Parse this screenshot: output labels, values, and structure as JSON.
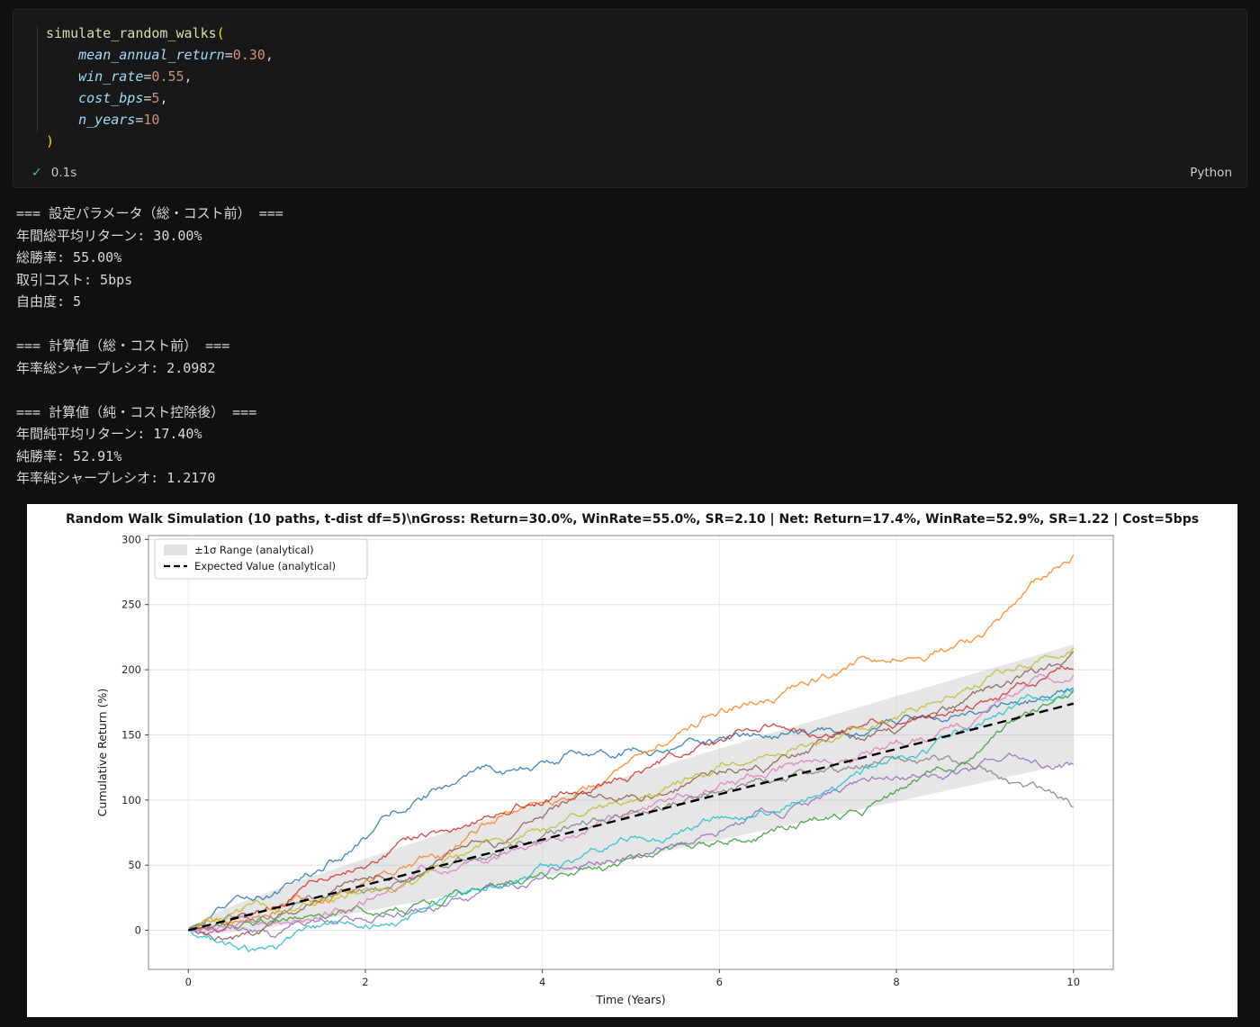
{
  "cell": {
    "execution_time": "0.1s",
    "kernel": "Python",
    "code_lines": [
      [
        {
          "text": "simulate_random_walks",
          "type": "func"
        },
        {
          "text": "(",
          "type": "bracket"
        }
      ],
      [
        {
          "text": "    ",
          "type": "plain"
        },
        {
          "text": "mean_annual_return",
          "type": "param"
        },
        {
          "text": "=",
          "type": "op"
        },
        {
          "text": "0.30",
          "type": "num"
        },
        {
          "text": ",",
          "type": "plain"
        }
      ],
      [
        {
          "text": "    ",
          "type": "plain"
        },
        {
          "text": "win_rate",
          "type": "param"
        },
        {
          "text": "=",
          "type": "op"
        },
        {
          "text": "0.55",
          "type": "num"
        },
        {
          "text": ",",
          "type": "plain"
        }
      ],
      [
        {
          "text": "    ",
          "type": "plain"
        },
        {
          "text": "cost_bps",
          "type": "param"
        },
        {
          "text": "=",
          "type": "op"
        },
        {
          "text": "5",
          "type": "num"
        },
        {
          "text": ",",
          "type": "plain"
        }
      ],
      [
        {
          "text": "    ",
          "type": "plain"
        },
        {
          "text": "n_years",
          "type": "param"
        },
        {
          "text": "=",
          "type": "op"
        },
        {
          "text": "10",
          "type": "num"
        }
      ],
      [
        {
          "text": ")",
          "type": "bracket"
        }
      ]
    ]
  },
  "output": {
    "lines": [
      "=== 設定パラメータ（総・コスト前） ===",
      "年間総平均リターン: 30.00%",
      "総勝率: 55.00%",
      "取引コスト: 5bps",
      "自由度: 5",
      "",
      "=== 計算値（総・コスト前） ===",
      "年率総シャープレシオ: 2.0982",
      "",
      "=== 計算値（純・コスト控除後） ===",
      "年間純平均リターン: 17.40%",
      "純勝率: 52.91%",
      "年率純シャープレシオ: 1.2170"
    ]
  },
  "chart_data": {
    "type": "line",
    "title": "Random Walk Simulation (10 paths, t-dist df=5)\\nGross: Return=30.0%, WinRate=55.0%, SR=2.10 | Net: Return=17.4%, WinRate=52.9%, SR=1.22 | Cost=5bps",
    "xlabel": "Time (Years)",
    "ylabel": "Cumulative Return (%)",
    "xlim": [
      -0.45,
      10.45
    ],
    "ylim": [
      -30,
      303
    ],
    "xticks": [
      0,
      2,
      4,
      6,
      8,
      10
    ],
    "yticks": [
      0,
      50,
      100,
      150,
      200,
      250,
      300
    ],
    "grid": true,
    "legend": {
      "position": "upper left",
      "entries": [
        {
          "label": "±1σ Range (analytical)",
          "type": "patch",
          "color": "#d9d9d9"
        },
        {
          "label": "Expected Value (analytical)",
          "type": "dashed-line",
          "color": "#000000"
        }
      ]
    },
    "expected_value": {
      "slope_pct_per_year": 17.4,
      "x": [
        0,
        10
      ],
      "y": [
        0,
        174
      ]
    },
    "sigma_band": {
      "mean_slope_pct_per_year": 17.4,
      "sigma_annual_pct": 14.3
    },
    "n_paths": 10,
    "series": [
      {
        "name": "path-1",
        "color": "#1f77b4",
        "x": [
          0,
          1,
          2,
          3,
          4,
          5,
          6,
          7,
          8,
          9,
          10
        ],
        "y": [
          0,
          28,
          70,
          112,
          130,
          138,
          148,
          150,
          158,
          168,
          186
        ]
      },
      {
        "name": "path-2",
        "color": "#ff7f0e",
        "x": [
          0,
          1,
          2,
          3,
          4,
          5,
          6,
          7,
          8,
          9,
          10
        ],
        "y": [
          0,
          14,
          38,
          62,
          98,
          132,
          168,
          188,
          207,
          228,
          288
        ]
      },
      {
        "name": "path-3",
        "color": "#2ca02c",
        "x": [
          0,
          1,
          2,
          3,
          4,
          5,
          6,
          7,
          8,
          9,
          10
        ],
        "y": [
          0,
          8,
          14,
          30,
          44,
          58,
          68,
          84,
          108,
          142,
          184
        ]
      },
      {
        "name": "path-4",
        "color": "#d62728",
        "x": [
          0,
          1,
          2,
          3,
          4,
          5,
          6,
          7,
          8,
          9,
          10
        ],
        "y": [
          0,
          18,
          48,
          78,
          96,
          118,
          146,
          150,
          158,
          176,
          200
        ]
      },
      {
        "name": "path-5",
        "color": "#9467bd",
        "x": [
          0,
          1,
          2,
          3,
          4,
          5,
          6,
          7,
          8,
          9,
          10
        ],
        "y": [
          0,
          -4,
          8,
          24,
          40,
          56,
          76,
          96,
          118,
          132,
          127
        ]
      },
      {
        "name": "path-6",
        "color": "#8c564b",
        "x": [
          0,
          1,
          2,
          3,
          4,
          5,
          6,
          7,
          8,
          9,
          10
        ],
        "y": [
          0,
          10,
          40,
          62,
          86,
          104,
          122,
          136,
          152,
          186,
          214
        ]
      },
      {
        "name": "path-7",
        "color": "#e377c2",
        "x": [
          0,
          1,
          2,
          3,
          4,
          5,
          6,
          7,
          8,
          9,
          10
        ],
        "y": [
          0,
          6,
          22,
          46,
          68,
          90,
          112,
          130,
          146,
          168,
          196
        ]
      },
      {
        "name": "path-8",
        "color": "#7f7f7f",
        "x": [
          0,
          1,
          2,
          3,
          4,
          5,
          6,
          7,
          8,
          9,
          10
        ],
        "y": [
          0,
          10,
          30,
          52,
          72,
          92,
          106,
          120,
          132,
          124,
          95
        ]
      },
      {
        "name": "path-9",
        "color": "#bcbd22",
        "x": [
          0,
          1,
          2,
          3,
          4,
          5,
          6,
          7,
          8,
          9,
          10
        ],
        "y": [
          0,
          14,
          32,
          56,
          78,
          100,
          126,
          142,
          162,
          192,
          217
        ]
      },
      {
        "name": "path-10",
        "color": "#17becf",
        "x": [
          0,
          1,
          2,
          3,
          4,
          5,
          6,
          7,
          8,
          9,
          10
        ],
        "y": [
          0,
          -14,
          4,
          26,
          50,
          72,
          86,
          102,
          132,
          162,
          185
        ]
      }
    ]
  }
}
